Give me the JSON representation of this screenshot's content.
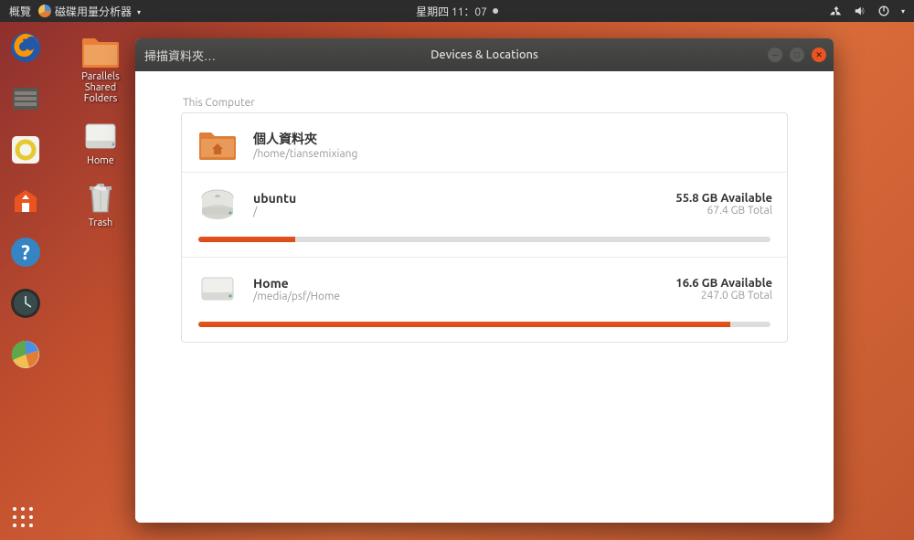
{
  "topbar": {
    "activities": "概覽",
    "app_name": "磁碟用量分析器",
    "clock": "星期四 11：07"
  },
  "desktop": {
    "parallels": "Parallels\nShared\nFolders",
    "home": "Home",
    "trash": "Trash"
  },
  "window": {
    "scan_button": "掃描資料夾…",
    "title": "Devices & Locations",
    "section": "This Computer",
    "drives": [
      {
        "name": "個人資料夾",
        "path": "/home/tiansemixiang",
        "available": "",
        "total": "",
        "usage_percent": 0,
        "icon": "folder"
      },
      {
        "name": "ubuntu",
        "path": "/",
        "available": "55.8 GB Available",
        "total": "67.4 GB Total",
        "usage_percent": 17,
        "icon": "disk"
      },
      {
        "name": "Home",
        "path": "/media/psf/Home",
        "available": "16.6 GB Available",
        "total": "247.0 GB Total",
        "usage_percent": 93,
        "icon": "disk"
      }
    ]
  }
}
